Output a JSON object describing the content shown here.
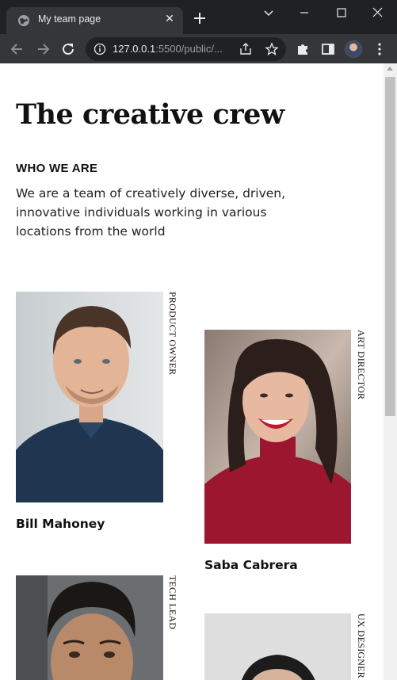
{
  "browser": {
    "tab_title": "My team page",
    "url_host": "127.0.0.1",
    "url_rest": ":5500/public/..."
  },
  "page": {
    "title": "The creative crew",
    "section_label": "WHO WE ARE",
    "intro": "We are a team of creatively diverse, driven, innovative individuals working in various locations from the world"
  },
  "team": [
    {
      "name": "Bill Mahoney",
      "role": "PRODUCT OWNER"
    },
    {
      "name": "Saba Cabrera",
      "role": "ART DIRECTOR"
    },
    {
      "role": "TECH LEAD"
    },
    {
      "role": "UX DESIGNER"
    }
  ],
  "colors": {
    "chrome_dark": "#202124",
    "chrome_tab": "#35363a",
    "text": "#111111"
  }
}
